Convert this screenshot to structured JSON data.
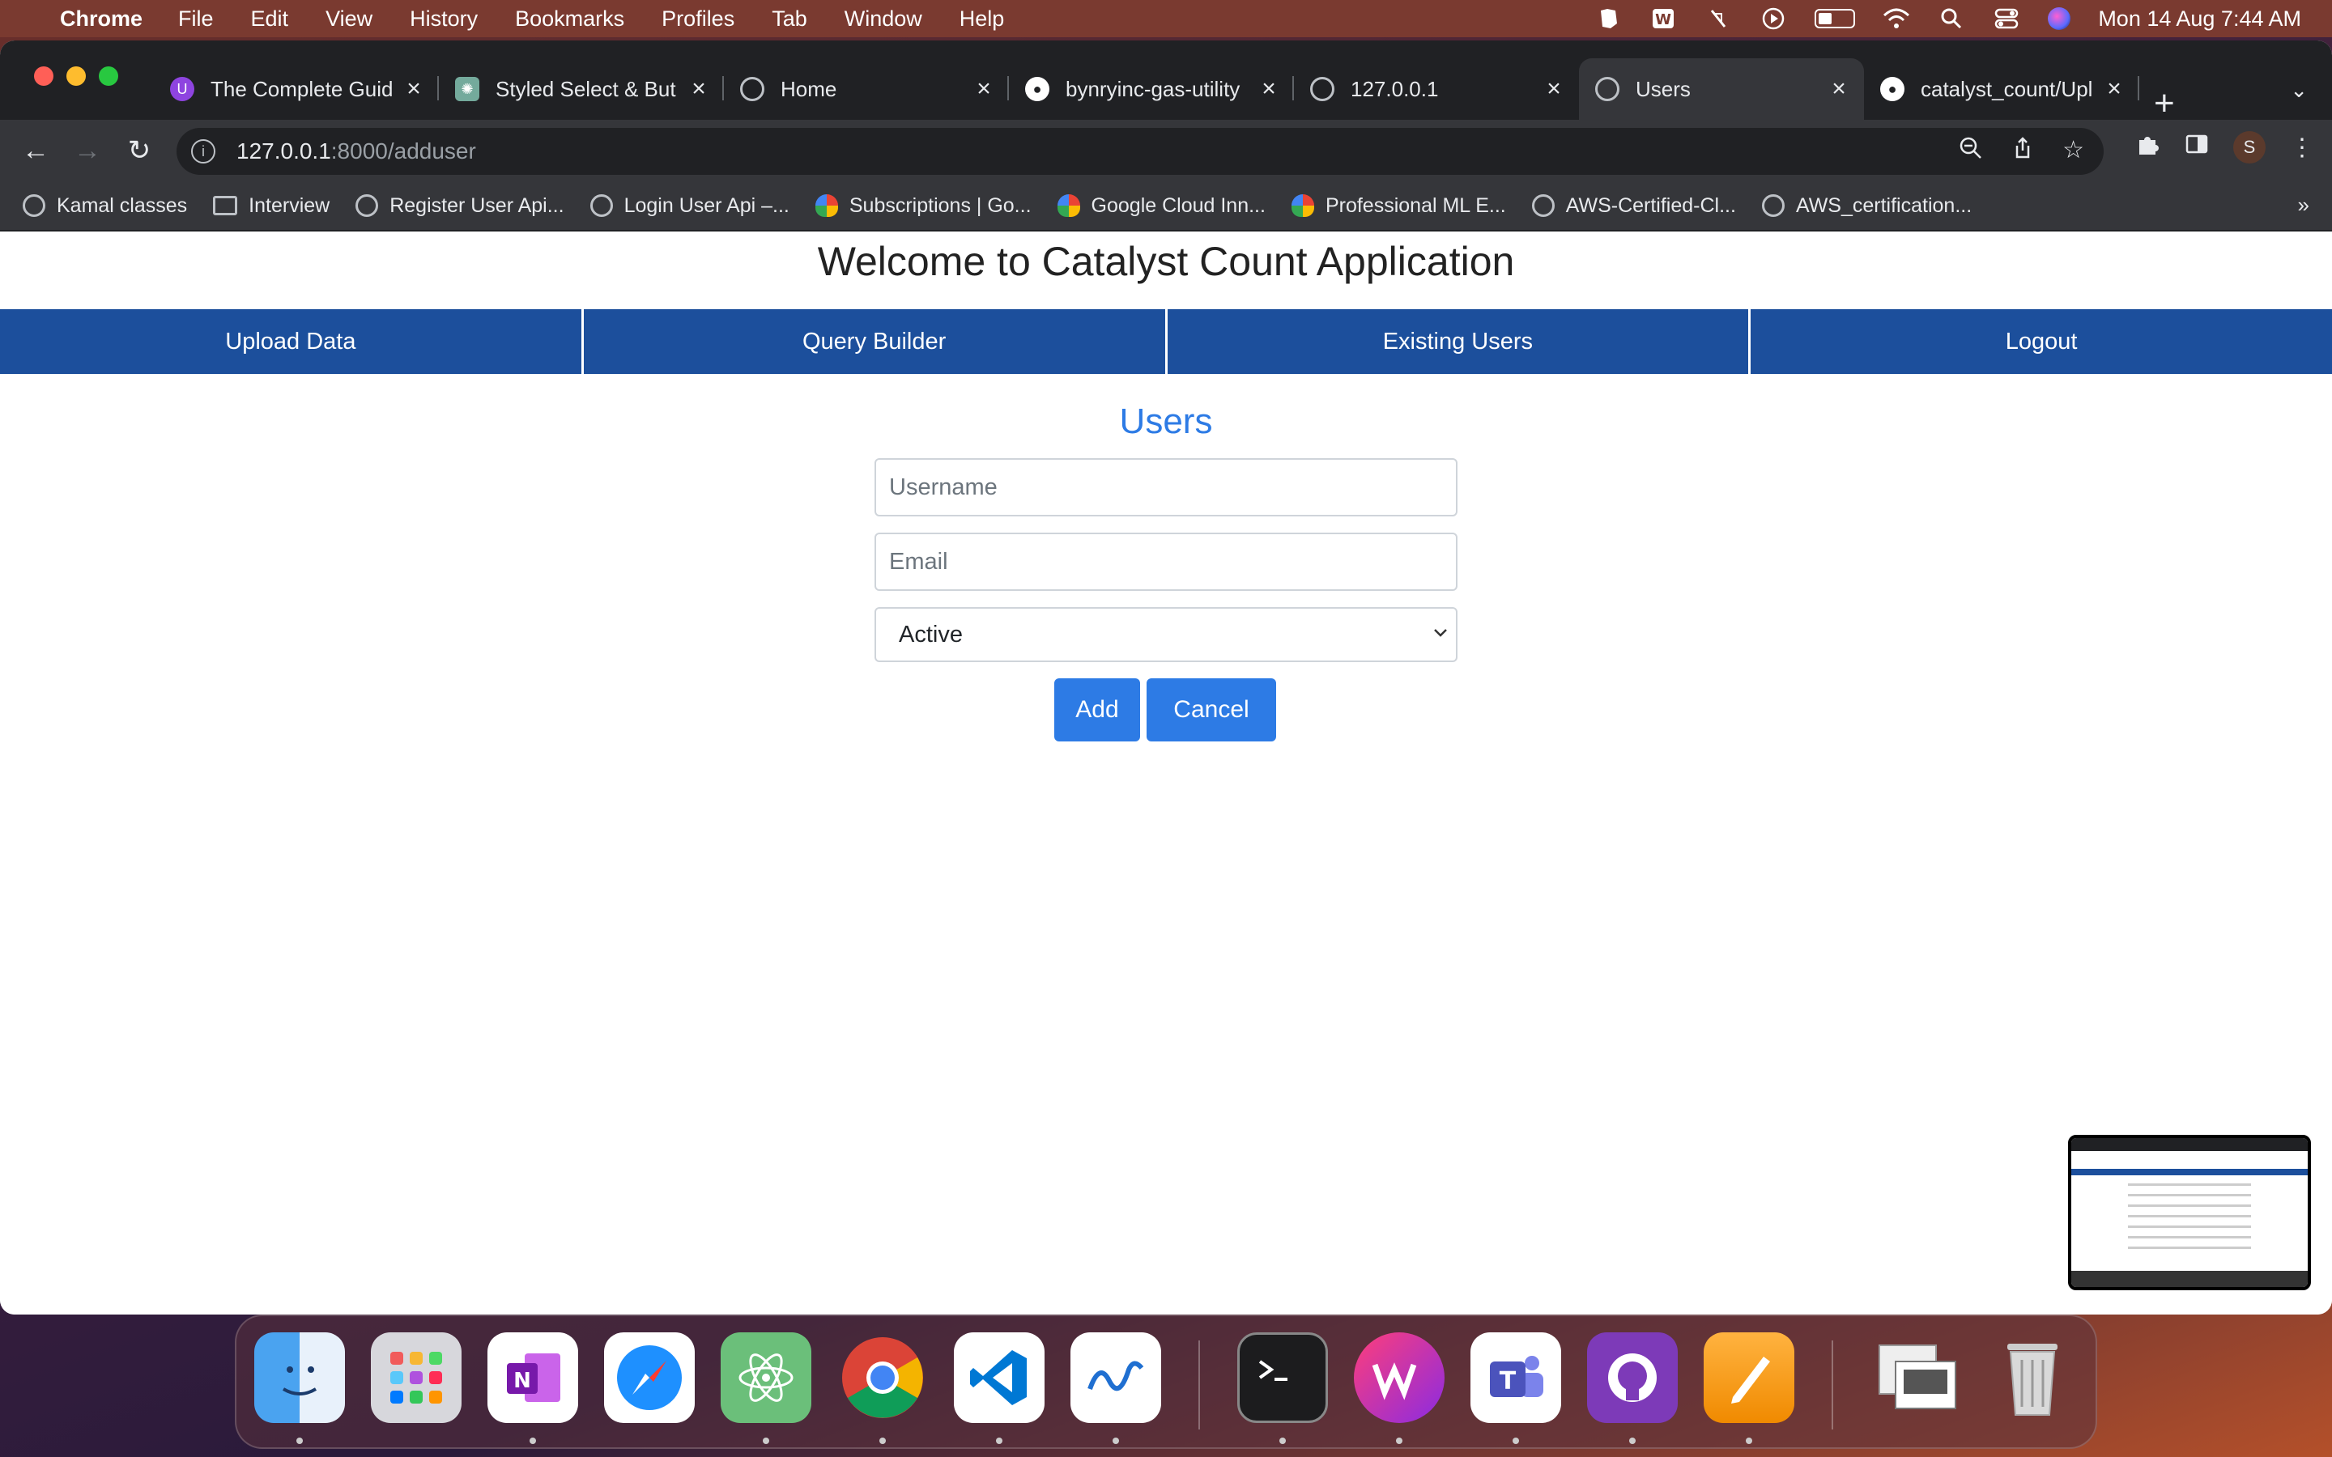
{
  "menubar": {
    "app_name": "Chrome",
    "items": [
      "File",
      "Edit",
      "View",
      "History",
      "Bookmarks",
      "Profiles",
      "Tab",
      "Window",
      "Help"
    ],
    "clock": "Mon 14 Aug  7:44 AM"
  },
  "tabs": [
    {
      "title": "The Complete Guid",
      "icon": "uplabs-icon"
    },
    {
      "title": "Styled Select & But",
      "icon": "chatgpt-icon"
    },
    {
      "title": "Home",
      "icon": "globe-icon"
    },
    {
      "title": "bynryinc-gas-utility",
      "icon": "github-icon"
    },
    {
      "title": "127.0.0.1",
      "icon": "globe-icon"
    },
    {
      "title": "Users",
      "icon": "globe-icon",
      "active": true
    },
    {
      "title": "catalyst_count/Upl",
      "icon": "github-icon"
    }
  ],
  "address": {
    "host": "127.0.0.1",
    "path": ":8000/adduser"
  },
  "profile_initial": "S",
  "bookmarks": [
    {
      "label": "Kamal classes",
      "icon": "globe-icon"
    },
    {
      "label": "Interview",
      "icon": "folder-icon"
    },
    {
      "label": "Register User Api...",
      "icon": "globe-icon"
    },
    {
      "label": "Login User Api –...",
      "icon": "globe-icon"
    },
    {
      "label": "Subscriptions | Go...",
      "icon": "google-cloud-icon"
    },
    {
      "label": "Google Cloud Inn...",
      "icon": "google-cloud-icon"
    },
    {
      "label": "Professional ML E...",
      "icon": "google-cloud-icon"
    },
    {
      "label": "AWS-Certified-Cl...",
      "icon": "globe-icon"
    },
    {
      "label": "AWS_certification...",
      "icon": "globe-icon"
    }
  ],
  "bookmarks_more": "»",
  "page": {
    "title": "Welcome to Catalyst Count Application",
    "nav": [
      "Upload Data",
      "Query Builder",
      "Existing Users",
      "Logout"
    ],
    "form_title": "Users",
    "username_placeholder": "Username",
    "email_placeholder": "Email",
    "status_selected": "Active",
    "add_label": "Add",
    "cancel_label": "Cancel"
  },
  "colors": {
    "nav_bg": "#1c4f9c",
    "accent": "#2d7be5"
  },
  "dock_apps": [
    "finder-icon",
    "launchpad-icon",
    "onenote-icon",
    "safari-icon",
    "atom-icon",
    "chrome-icon",
    "vscode-icon",
    "freeform-icon",
    "terminal-icon",
    "wps-icon",
    "teams-icon",
    "github-desktop-icon",
    "pages-icon",
    "preview-icon",
    "trash-icon"
  ]
}
